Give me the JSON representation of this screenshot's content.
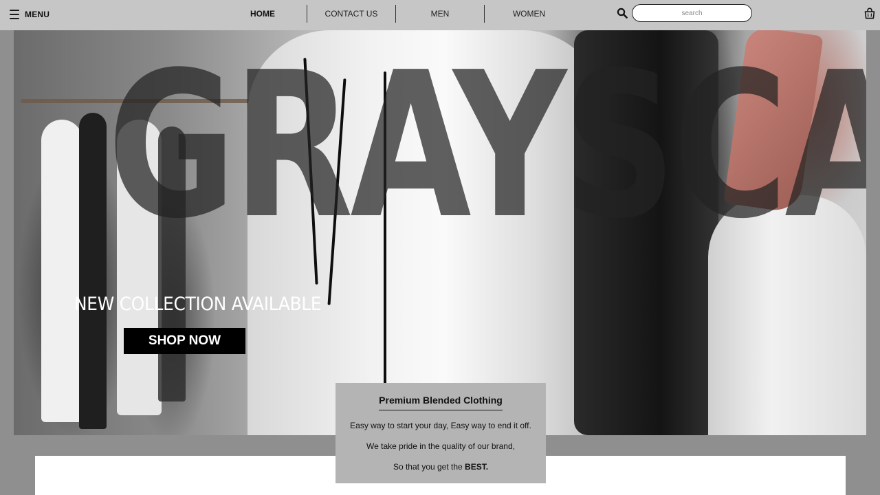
{
  "header": {
    "menu_label": "MENU",
    "nav": [
      {
        "label": "HOME",
        "active": true
      },
      {
        "label": "CONTACT US",
        "active": false
      },
      {
        "label": "MEN",
        "active": false
      },
      {
        "label": "WOMEN",
        "active": false
      }
    ],
    "search_placeholder": "search",
    "icons": [
      "hamburger-icon",
      "search-icon",
      "shopping-bag-icon"
    ]
  },
  "hero": {
    "brand_text": "GRAYSCALE",
    "tagline": "NEW COLLECTION AVAILABLE",
    "cta_label": "SHOP NOW"
  },
  "promo": {
    "title": "Premium Blended Clothing",
    "line1": "Easy way to start your day, Easy way to end it off.",
    "line2": "We take pride in the quality of our brand,",
    "line3_prefix": "So that you get the ",
    "line3_emphasis": "BEST."
  },
  "colors": {
    "topbar": "#c6c6c6",
    "page_bg": "#8f8f8f",
    "promo_bg": "#b4b4b4",
    "button_bg": "#000000"
  }
}
